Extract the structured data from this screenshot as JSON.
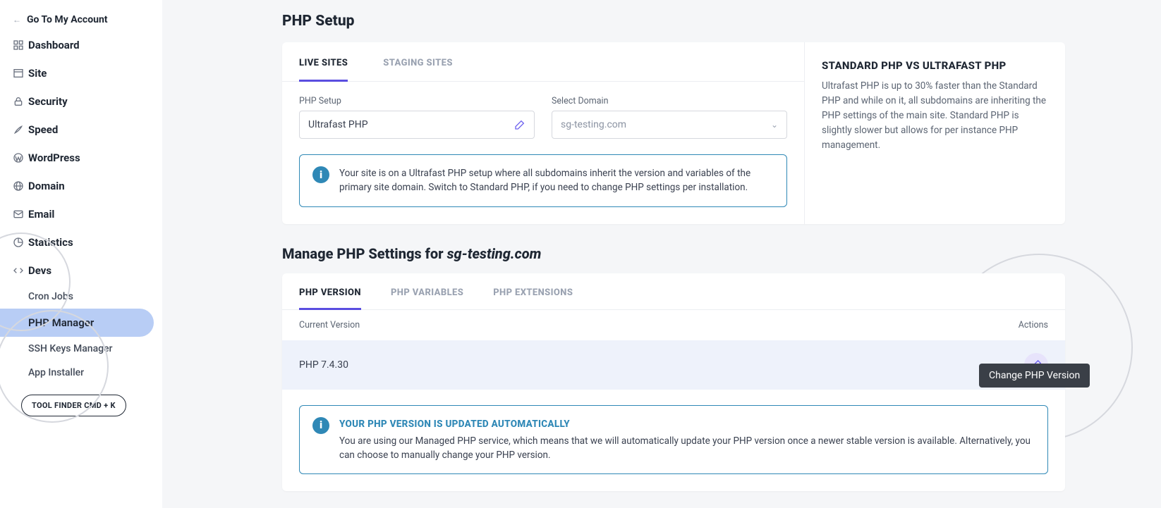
{
  "go_account": "Go To My Account",
  "nav": {
    "dashboard": "Dashboard",
    "site": "Site",
    "security": "Security",
    "speed": "Speed",
    "wordpress": "WordPress",
    "domain": "Domain",
    "email": "Email",
    "statistics": "Statistics",
    "devs": "Devs"
  },
  "devs_sub": {
    "cron": "Cron Jobs",
    "php_manager": "PHP Manager",
    "ssh": "SSH Keys Manager",
    "app_installer": "App Installer"
  },
  "tool_finder": "TOOL FINDER CMD + K",
  "page_title": "PHP Setup",
  "setup_tabs": {
    "live": "LIVE SITES",
    "staging": "STAGING SITES"
  },
  "setup_fields": {
    "php_setup_label": "PHP Setup",
    "php_setup_value": "Ultrafast PHP",
    "domain_label": "Select Domain",
    "domain_value": "sg-testing.com"
  },
  "setup_banner": "Your site is on a Ultrafast PHP setup where all subdomains inherit the version and variables of the primary site domain. Switch to Standard PHP, if you need to change PHP settings per installation.",
  "compare": {
    "title": "STANDARD PHP VS ULTRAFAST PHP",
    "body": "Ultrafast PHP is up to 30% faster than the Standard PHP and while on it, all subdomains are inheriting the PHP settings of the main site. Standard PHP is slightly slower but allows for per instance PHP management."
  },
  "manage_title_prefix": "Manage PHP Settings for ",
  "manage_title_domain": "sg-testing.com",
  "manage_tabs": {
    "version": "PHP VERSION",
    "variables": "PHP VARIABLES",
    "extensions": "PHP EXTENSIONS"
  },
  "table": {
    "head_left": "Current Version",
    "head_right": "Actions",
    "row_version": "PHP 7.4.30"
  },
  "auto_banner": {
    "title": "YOUR PHP VERSION IS UPDATED AUTOMATICALLY",
    "body": "You are using our Managed PHP service, which means that we will automatically update your PHP version once a newer stable version is available. Alternatively, you can choose to manually change your PHP version."
  },
  "tooltip": "Change PHP Version"
}
